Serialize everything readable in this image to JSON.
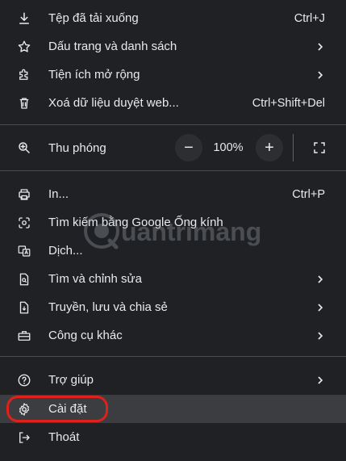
{
  "menu": {
    "items": [
      {
        "label": "Tệp đã tải xuống",
        "shortcut": "Ctrl+J",
        "icon": "download-icon"
      },
      {
        "label": "Dấu trang và danh sách",
        "icon": "star-icon",
        "submenu": true
      },
      {
        "label": "Tiện ích mở rộng",
        "icon": "extension-icon",
        "submenu": true
      },
      {
        "label": "Xoá dữ liệu duyệt web...",
        "shortcut": "Ctrl+Shift+Del",
        "icon": "trash-icon"
      }
    ],
    "zoom": {
      "label": "Thu phóng",
      "minus": "−",
      "value": "100%",
      "plus": "+",
      "icon": "zoom-icon"
    },
    "items2": [
      {
        "label": "In...",
        "shortcut": "Ctrl+P",
        "icon": "printer-icon"
      },
      {
        "label": "Tìm kiếm bằng Google Ống kính",
        "icon": "google-lens-icon"
      },
      {
        "label": "Dịch...",
        "icon": "translate-icon"
      },
      {
        "label": "Tìm và chỉnh sửa",
        "icon": "find-edit-icon",
        "submenu": true
      },
      {
        "label": "Truyền, lưu và chia sẻ",
        "icon": "save-share-icon",
        "submenu": true
      },
      {
        "label": "Công cụ khác",
        "icon": "toolbox-icon",
        "submenu": true
      }
    ],
    "items3": [
      {
        "label": "Trợ giúp",
        "icon": "help-icon",
        "submenu": true
      },
      {
        "label": "Cài đặt",
        "icon": "gear-icon"
      },
      {
        "label": "Thoát",
        "icon": "exit-icon"
      }
    ]
  },
  "watermark": {
    "text": "uantrimang"
  },
  "colors": {
    "background": "#202124",
    "highlight": "#3c3d40",
    "annotation": "#e0201b",
    "text": "#e8eaed"
  }
}
